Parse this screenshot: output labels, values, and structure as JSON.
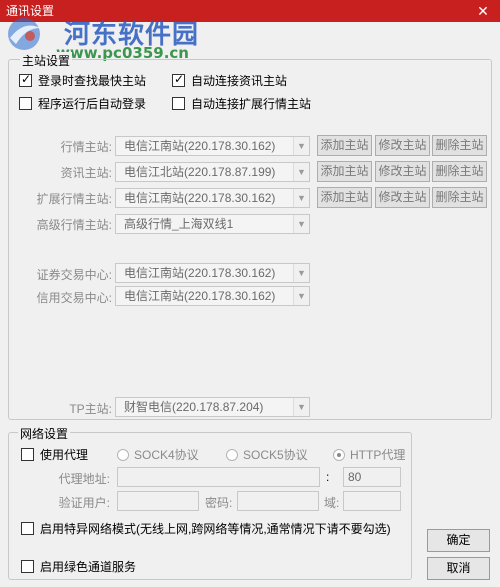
{
  "window": {
    "title": "通讯设置",
    "close_glyph": "✕"
  },
  "watermark": {
    "name": "河东软件园",
    "url": "www.pc0359.cn"
  },
  "main_group": {
    "legend": "主站设置",
    "checkboxes": [
      {
        "label": "登录时查找最快主站",
        "checked": true
      },
      {
        "label": "自动连接资讯主站",
        "checked": true
      },
      {
        "label": "程序运行后自动登录",
        "checked": false
      },
      {
        "label": "自动连接扩展行情主站",
        "checked": false
      }
    ],
    "rows": [
      {
        "label": "行情主站:",
        "value": "电信江南站(220.178.30.162)",
        "buttons": [
          "添加主站",
          "修改主站",
          "删除主站"
        ]
      },
      {
        "label": "资讯主站:",
        "value": "电信江北站(220.178.87.199)",
        "buttons": [
          "添加主站",
          "修改主站",
          "删除主站"
        ]
      },
      {
        "label": "扩展行情主站:",
        "value": "电信江南站(220.178.30.162)",
        "buttons": [
          "添加主站",
          "修改主站",
          "删除主站"
        ]
      },
      {
        "label": "高级行情主站:",
        "value": "高级行情_上海双线1",
        "buttons": []
      },
      {
        "label": "证券交易中心:",
        "value": "电信江南站(220.178.30.162)",
        "buttons": []
      },
      {
        "label": "信用交易中心:",
        "value": "电信江南站(220.178.30.162)",
        "buttons": []
      },
      {
        "label": "TP主站:",
        "value": "财智电信(220.178.87.204)",
        "buttons": []
      }
    ]
  },
  "network_group": {
    "legend": "网络设置",
    "use_proxy": {
      "label": "使用代理",
      "checked": false
    },
    "proxy_types": [
      {
        "label": "SOCK4协议",
        "selected": false
      },
      {
        "label": "SOCK5协议",
        "selected": false
      },
      {
        "label": "HTTP代理",
        "selected": true
      }
    ],
    "proxy_address_label": "代理地址:",
    "proxy_address_value": "",
    "port_separator": ":",
    "port_value": "80",
    "auth_user_label": "验证用户:",
    "auth_user_value": "",
    "password_label": "密码:",
    "password_value": "",
    "domain_label": "域:",
    "domain_value": "",
    "special_mode": {
      "label": "启用特异网络模式(无线上网,跨网络等情况,通常情况下请不要勾选)",
      "checked": false
    },
    "green_channel": {
      "label": "启用绿色通道服务",
      "checked": false
    }
  },
  "footer": {
    "ok_label": "确定",
    "cancel_label": "取消"
  },
  "colors": {
    "titlebar": "#c8201e",
    "watermark_name": "#285abe",
    "watermark_url": "#288c3c"
  }
}
